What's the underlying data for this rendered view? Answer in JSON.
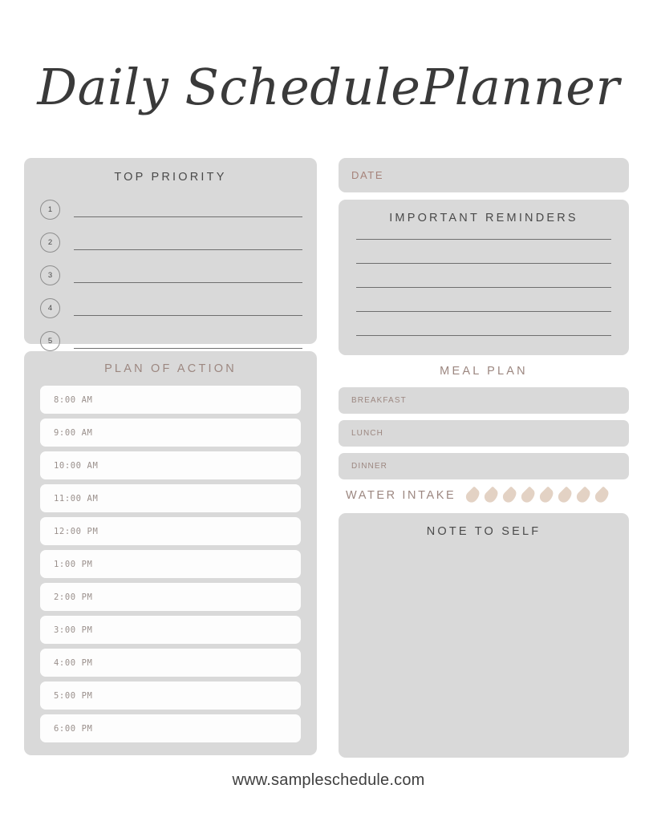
{
  "title": "Daily SchedulePlanner",
  "footer": "www.sampleschedule.com",
  "colors": {
    "panel": "#d9d9d9",
    "accent_brown": "#9c8780",
    "date_brown": "#a6837a",
    "heading_dark": "#4a4a4a",
    "slot_white": "#fdfdfd",
    "droplet": "#e3d2c4",
    "line": "#6f6f6f"
  },
  "top_priority": {
    "heading": "TOP PRIORITY",
    "items": [
      {
        "number": "1",
        "value": ""
      },
      {
        "number": "2",
        "value": ""
      },
      {
        "number": "3",
        "value": ""
      },
      {
        "number": "4",
        "value": ""
      },
      {
        "number": "5",
        "value": ""
      }
    ]
  },
  "plan_of_action": {
    "heading": "PLAN OF ACTION",
    "slots": [
      {
        "time": "8:00 AM",
        "value": ""
      },
      {
        "time": "9:00 AM",
        "value": ""
      },
      {
        "time": "10:00 AM",
        "value": ""
      },
      {
        "time": "11:00 AM",
        "value": ""
      },
      {
        "time": "12:00 PM",
        "value": ""
      },
      {
        "time": "1:00 PM",
        "value": ""
      },
      {
        "time": "2:00 PM",
        "value": ""
      },
      {
        "time": "3:00 PM",
        "value": ""
      },
      {
        "time": "4:00 PM",
        "value": ""
      },
      {
        "time": "5:00 PM",
        "value": ""
      },
      {
        "time": "6:00 PM",
        "value": ""
      }
    ]
  },
  "date": {
    "label": "DATE",
    "value": ""
  },
  "important_reminders": {
    "heading": "IMPORTANT REMINDERS",
    "lines": [
      "",
      "",
      "",
      "",
      ""
    ]
  },
  "meal_plan": {
    "heading": "MEAL PLAN",
    "meals": [
      {
        "label": "BREAKFAST",
        "value": ""
      },
      {
        "label": "LUNCH",
        "value": ""
      },
      {
        "label": "DINNER",
        "value": ""
      }
    ]
  },
  "water_intake": {
    "label": "WATER INTAKE",
    "total": 8,
    "filled": 0,
    "icon": "water-drop-icon"
  },
  "note_to_self": {
    "heading": "NOTE TO SELF",
    "value": ""
  }
}
